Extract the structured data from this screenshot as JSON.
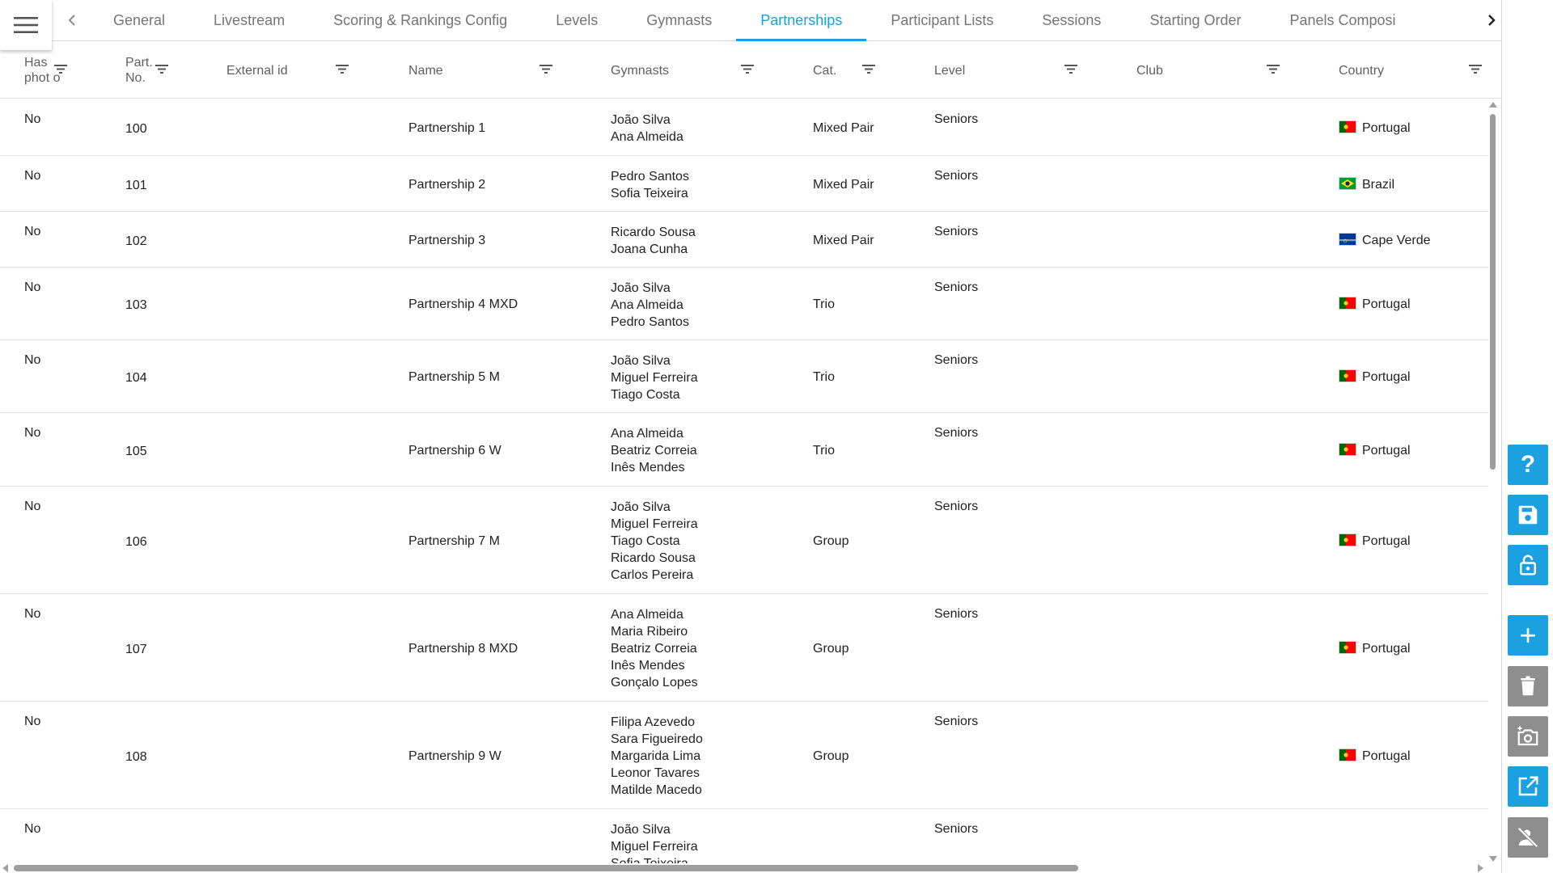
{
  "tabs": {
    "items": [
      "General",
      "Livestream",
      "Scoring & Rankings Config",
      "Levels",
      "Gymnasts",
      "Partnerships",
      "Participant Lists",
      "Sessions",
      "Starting Order",
      "Panels Composi"
    ],
    "active_index": 5
  },
  "table": {
    "columns": [
      {
        "key": "has_photo",
        "label": "Has phot o"
      },
      {
        "key": "part_no",
        "label": "Part. No."
      },
      {
        "key": "external_id",
        "label": "External id"
      },
      {
        "key": "name",
        "label": "Name"
      },
      {
        "key": "gymnasts",
        "label": "Gymnasts"
      },
      {
        "key": "cat",
        "label": "Cat."
      },
      {
        "key": "level",
        "label": "Level"
      },
      {
        "key": "club",
        "label": "Club"
      },
      {
        "key": "country",
        "label": "Country"
      }
    ],
    "rows": [
      {
        "has_photo": "No",
        "part_no": "100",
        "external_id": "",
        "name": "Partnership 1",
        "gymnasts": [
          "João Silva",
          "Ana Almeida"
        ],
        "cat": "Mixed Pair",
        "level": "Seniors",
        "club": "",
        "country": "Portugal",
        "flag": "portugal-flag-icon"
      },
      {
        "has_photo": "No",
        "part_no": "101",
        "external_id": "",
        "name": "Partnership 2",
        "gymnasts": [
          "Pedro Santos",
          "Sofia Teixeira"
        ],
        "cat": "Mixed Pair",
        "level": "Seniors",
        "club": "",
        "country": "Brazil",
        "flag": "brazil-flag-icon"
      },
      {
        "has_photo": "No",
        "part_no": "102",
        "external_id": "",
        "name": "Partnership 3",
        "gymnasts": [
          "Ricardo Sousa",
          "Joana Cunha"
        ],
        "cat": "Mixed Pair",
        "level": "Seniors",
        "club": "",
        "country": "Cape Verde",
        "flag": "cape-verde-flag-icon"
      },
      {
        "has_photo": "No",
        "part_no": "103",
        "external_id": "",
        "name": "Partnership 4 MXD",
        "gymnasts": [
          "João Silva",
          "Ana Almeida",
          "Pedro Santos"
        ],
        "cat": "Trio",
        "level": "Seniors",
        "club": "",
        "country": "Portugal",
        "flag": "portugal-flag-icon"
      },
      {
        "has_photo": "No",
        "part_no": "104",
        "external_id": "",
        "name": "Partnership 5 M",
        "gymnasts": [
          "João Silva",
          "Miguel Ferreira",
          "Tiago Costa"
        ],
        "cat": "Trio",
        "level": "Seniors",
        "club": "",
        "country": "Portugal",
        "flag": "portugal-flag-icon"
      },
      {
        "has_photo": "No",
        "part_no": "105",
        "external_id": "",
        "name": "Partnership 6 W",
        "gymnasts": [
          "Ana Almeida",
          "Beatriz Correia",
          "Inês Mendes"
        ],
        "cat": "Trio",
        "level": "Seniors",
        "club": "",
        "country": "Portugal",
        "flag": "portugal-flag-icon"
      },
      {
        "has_photo": "No",
        "part_no": "106",
        "external_id": "",
        "name": "Partnership 7 M",
        "gymnasts": [
          "João Silva",
          "Miguel Ferreira",
          "Tiago Costa",
          "Ricardo Sousa",
          "Carlos Pereira"
        ],
        "cat": "Group",
        "level": "Seniors",
        "club": "",
        "country": "Portugal",
        "flag": "portugal-flag-icon"
      },
      {
        "has_photo": "No",
        "part_no": "107",
        "external_id": "",
        "name": "Partnership 8 MXD",
        "gymnasts": [
          "Ana Almeida",
          "Maria Ribeiro",
          "Beatriz Correia",
          "Inês Mendes",
          "Gonçalo Lopes"
        ],
        "cat": "Group",
        "level": "Seniors",
        "club": "",
        "country": "Portugal",
        "flag": "portugal-flag-icon"
      },
      {
        "has_photo": "No",
        "part_no": "108",
        "external_id": "",
        "name": "Partnership 9 W",
        "gymnasts": [
          "Filipa Azevedo",
          "Sara Figueiredo",
          "Margarida Lima",
          "Leonor Tavares",
          "Matilde Macedo"
        ],
        "cat": "Group",
        "level": "Seniors",
        "club": "",
        "country": "Portugal",
        "flag": "portugal-flag-icon"
      },
      {
        "has_photo": "No",
        "part_no": "",
        "external_id": "",
        "name": "",
        "gymnasts": [
          "João Silva",
          "Miguel Ferreira",
          "Sofia Teixeira"
        ],
        "cat": "",
        "level": "Seniors",
        "club": "",
        "country": "",
        "flag": ""
      }
    ]
  },
  "side_actions": [
    {
      "name": "help-button",
      "icon": "help-icon",
      "color": "#1ba1e2"
    },
    {
      "name": "save-button",
      "icon": "save-icon",
      "color": "#1ba1e2"
    },
    {
      "name": "unlock-button",
      "icon": "unlock-icon",
      "color": "#1ba1e2"
    },
    {
      "name": "add-button",
      "icon": "plus-icon",
      "color": "#1ba1e2"
    },
    {
      "name": "delete-button",
      "icon": "trash-icon",
      "color": "#8e8e8e"
    },
    {
      "name": "add-photo-button",
      "icon": "add-photo-icon",
      "color": "#8e8e8e"
    },
    {
      "name": "open-external-button",
      "icon": "open-external-icon",
      "color": "#1ba1e2"
    },
    {
      "name": "hide-person-button",
      "icon": "person-off-icon",
      "color": "#8e8e8e"
    }
  ],
  "colors": {
    "accent": "#1ba1d8",
    "fab_blue": "#1ba1e2",
    "fab_gray": "#8e8e8e"
  }
}
